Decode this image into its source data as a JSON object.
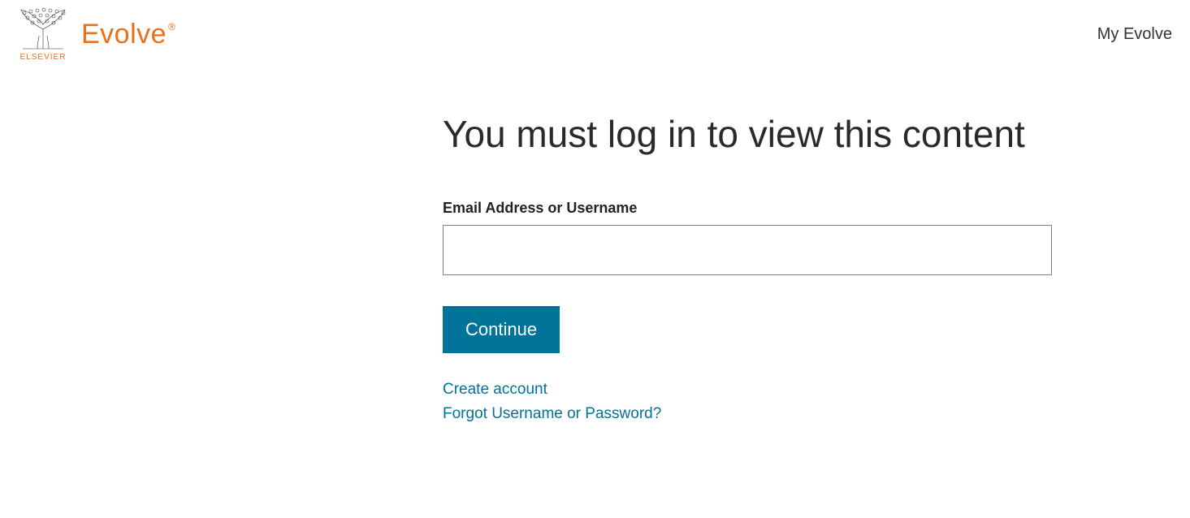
{
  "header": {
    "publisher_label": "ELSEVIER",
    "product_name": "Evolve",
    "nav_my_evolve": "My Evolve"
  },
  "main": {
    "title": "You must log in to view this content",
    "field_label": "Email Address or Username",
    "input_value": "",
    "continue_label": "Continue",
    "create_account_label": "Create account",
    "forgot_label": "Forgot Username or Password?"
  },
  "colors": {
    "brand_orange": "#e9711c",
    "accent_teal": "#007398"
  }
}
